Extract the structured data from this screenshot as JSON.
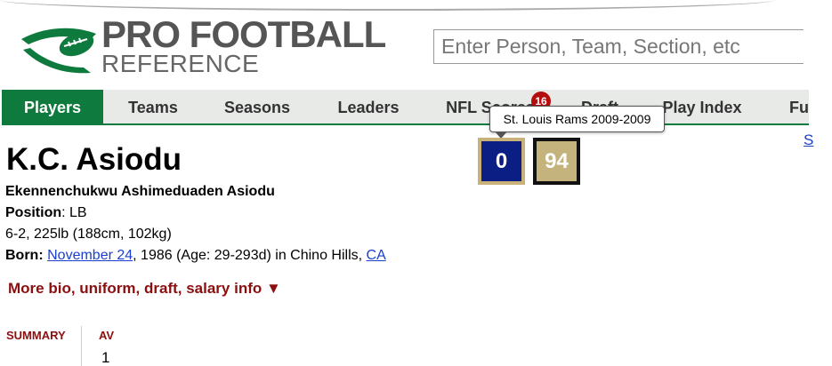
{
  "search": {
    "placeholder": "Enter Person, Team, Section, etc"
  },
  "logo": {
    "line1": "PRO FOOTBALL",
    "line2": "REFERENCE"
  },
  "nav": {
    "items": [
      {
        "label": "Players",
        "active": true
      },
      {
        "label": "Teams"
      },
      {
        "label": "Seasons"
      },
      {
        "label": "Leaders"
      },
      {
        "label": "NFL Scores"
      },
      {
        "label": "Draft"
      },
      {
        "label": "Play Index"
      },
      {
        "label": "Fu"
      }
    ],
    "scores_badge": "16"
  },
  "tooltip": {
    "text": "St. Louis Rams 2009-2009"
  },
  "side_link": "S",
  "uniforms": [
    {
      "number": "0",
      "bg": "#0b1e84",
      "border": "#c9b27a"
    },
    {
      "number": "94",
      "bg": "#c5b37e",
      "border": "#111111"
    }
  ],
  "player": {
    "name": "K.C. Asiodu",
    "full_name": "Ekennenchukwu Ashimeduaden Asiodu",
    "position_label": "Position",
    "position_value": ": LB",
    "size": "6-2, 225lb (188cm, 102kg)",
    "born_label": "Born:",
    "born_date": "November 24",
    "born_year_age": ", 1986 (Age: 29-293d) in Chino Hills, ",
    "born_state": "CA"
  },
  "bio_toggle": "More bio, uniform, draft, salary info ▼",
  "summary": {
    "label": "SUMMARY",
    "av_label": "AV",
    "av_value": "1"
  },
  "colors": {
    "green": "#0f7a3d",
    "accent_red": "#8b0f0f",
    "link": "#1a3fcf"
  }
}
